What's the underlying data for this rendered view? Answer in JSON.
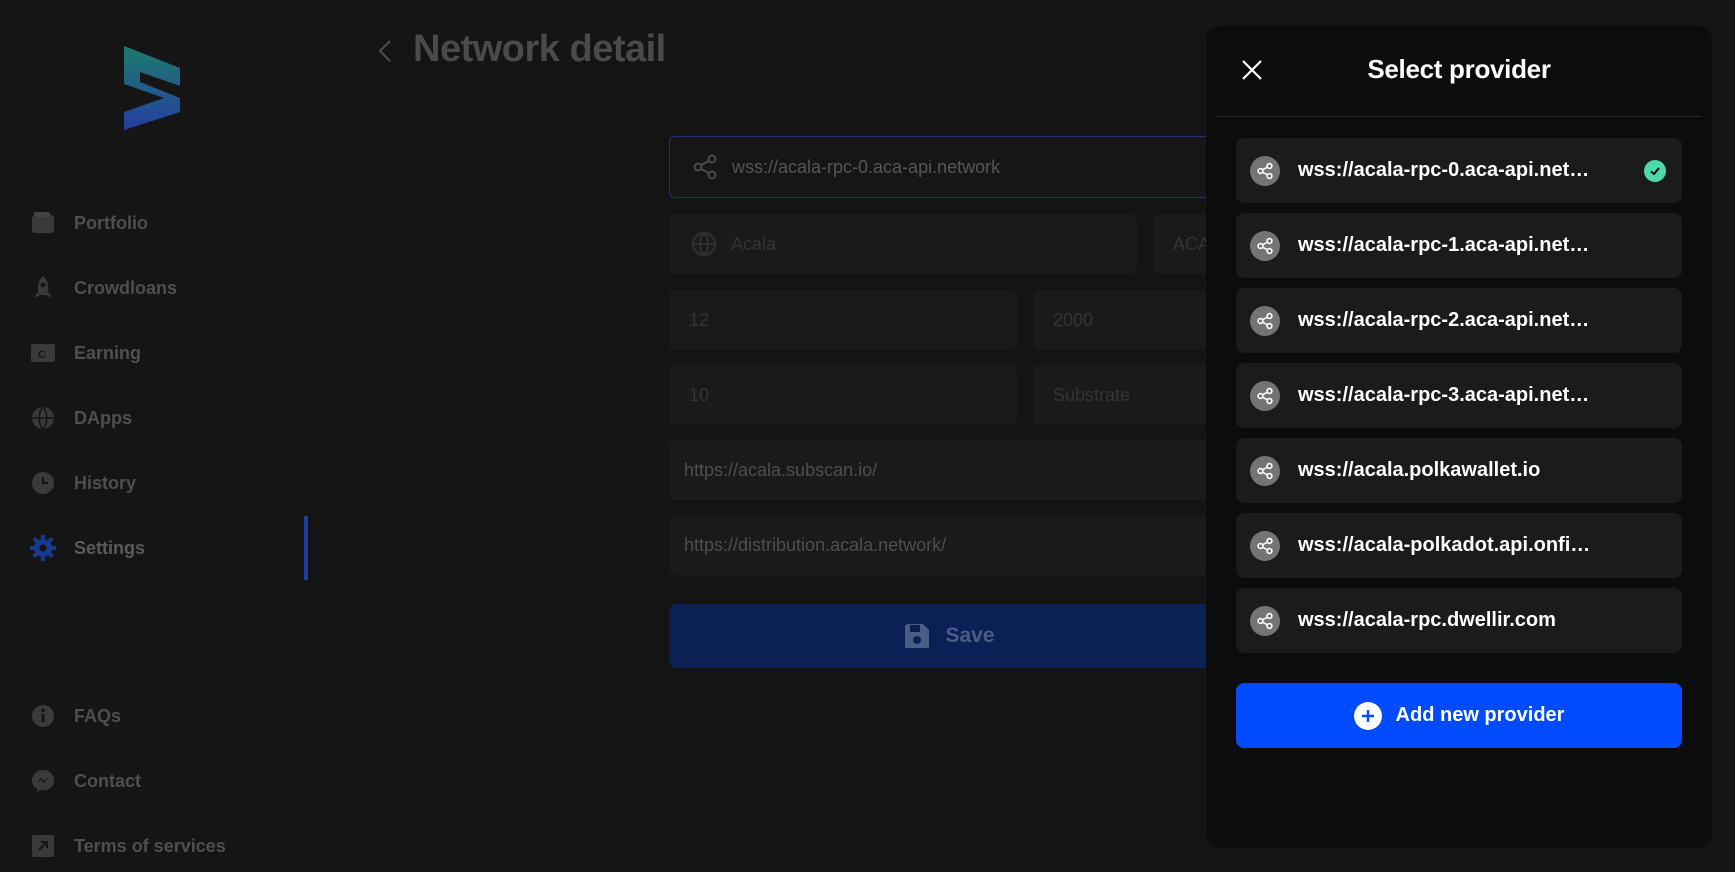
{
  "sidebar": {
    "items": [
      {
        "label": "Portfolio",
        "icon": "wallet-icon"
      },
      {
        "label": "Crowdloans",
        "icon": "rocket-icon"
      },
      {
        "label": "Earning",
        "icon": "earning-icon"
      },
      {
        "label": "DApps",
        "icon": "globe-icon"
      },
      {
        "label": "History",
        "icon": "clock-icon"
      },
      {
        "label": "Settings",
        "icon": "gear-icon",
        "active": true
      },
      {
        "label": "FAQs",
        "icon": "info-icon"
      },
      {
        "label": "Contact",
        "icon": "messenger-icon"
      },
      {
        "label": "Terms of services",
        "icon": "external-link-icon"
      }
    ]
  },
  "page": {
    "title": "Network detail"
  },
  "form": {
    "provider": "wss://acala-rpc-0.aca-api.network",
    "name": "Acala",
    "symbol": "ACA",
    "decimals": "12",
    "chain_id": "2000",
    "ed": "10",
    "type": "Substrate",
    "explorer": "https://acala.subscan.io/",
    "crowdloan_url": "https://distribution.acala.network/",
    "save_label": "Save"
  },
  "modal": {
    "title": "Select provider",
    "providers": [
      {
        "label": "wss://acala-rpc-0.aca-api.net…",
        "selected": true
      },
      {
        "label": "wss://acala-rpc-1.aca-api.net…"
      },
      {
        "label": "wss://acala-rpc-2.aca-api.net…"
      },
      {
        "label": "wss://acala-rpc-3.aca-api.net…"
      },
      {
        "label": "wss://acala.polkawallet.io"
      },
      {
        "label": "wss://acala-polkadot.api.onfi…"
      },
      {
        "label": "wss://acala-rpc.dwellir.com"
      }
    ],
    "add_label": "Add new provider"
  },
  "colors": {
    "accent": "#004bff",
    "check": "#4cd9ac",
    "brand_gradient_top": "#1f9e8a",
    "brand_gradient_bottom": "#2a4bd0"
  }
}
